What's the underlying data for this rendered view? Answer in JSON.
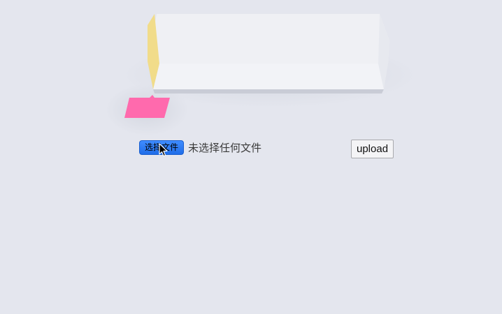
{
  "file_input": {
    "button_label": "选择文件",
    "status_text": "未选择任何文件"
  },
  "upload": {
    "label": "upload"
  },
  "colors": {
    "background": "#e4e6ee",
    "box_face": "#f1f2f6",
    "box_end": "#f1dc8a",
    "sticky_note": "#ff6aad",
    "choose_button": "#2a7cf5"
  },
  "icons": {
    "cursor": "arrow-pointer-icon"
  }
}
